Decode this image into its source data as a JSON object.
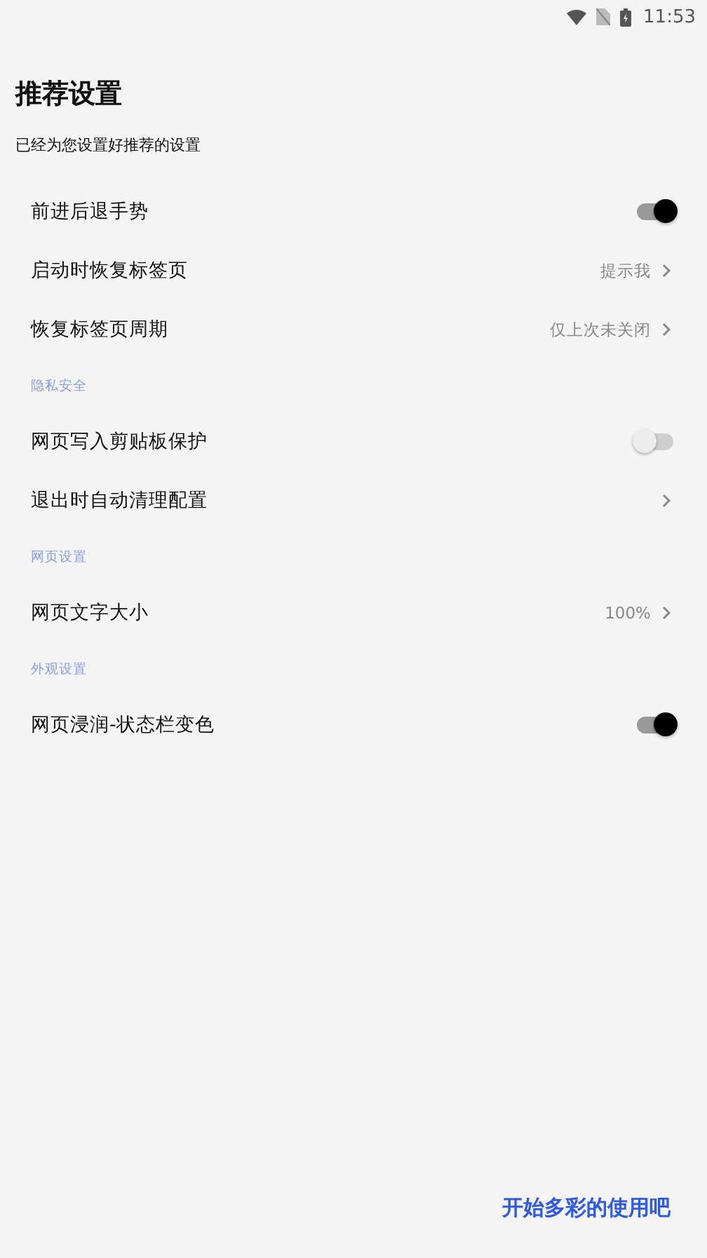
{
  "status_bar": {
    "time": "11:53"
  },
  "title": "推荐设置",
  "subtitle": "已经为您设置好推荐的设置",
  "items": [
    {
      "kind": "toggle",
      "label": "前进后退手势",
      "on": true
    },
    {
      "kind": "link",
      "label": "启动时恢复标签页",
      "value": "提示我"
    },
    {
      "kind": "link",
      "label": "恢复标签页周期",
      "value": "仅上次未关闭"
    },
    {
      "kind": "section",
      "label": "隐私安全"
    },
    {
      "kind": "toggle",
      "label": "网页写入剪贴板保护",
      "on": false
    },
    {
      "kind": "link",
      "label": "退出时自动清理配置"
    },
    {
      "kind": "section",
      "label": "网页设置"
    },
    {
      "kind": "link",
      "label": "网页文字大小",
      "value": "100%"
    },
    {
      "kind": "section",
      "label": "外观设置"
    },
    {
      "kind": "toggle",
      "label": "网页浸润-状态栏变色",
      "on": true
    }
  ],
  "action_button": "开始多彩的使用吧"
}
